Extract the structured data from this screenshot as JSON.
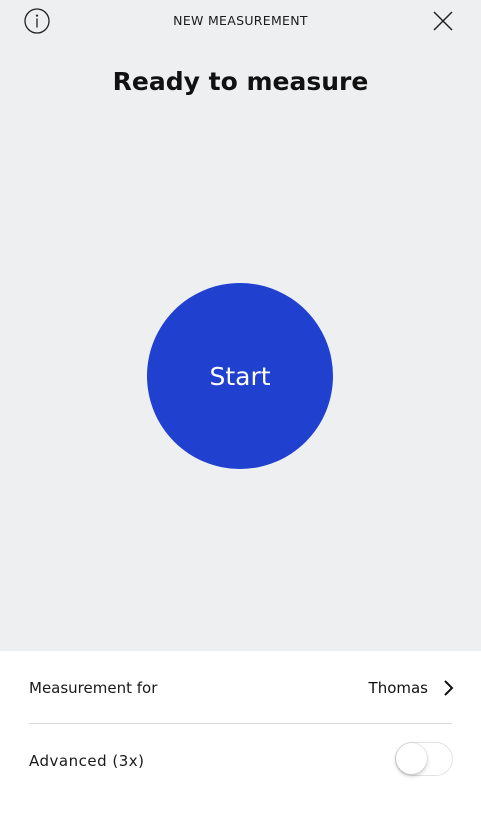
{
  "header": {
    "title": "NEW MEASUREMENT",
    "info_icon": "info-icon",
    "close_icon": "close-icon"
  },
  "main": {
    "title": "Ready to measure",
    "start_label": "Start",
    "accent_color": "#2040d0",
    "background_color": "#eeeff1"
  },
  "settings": {
    "measurement_for_label": "Measurement for",
    "measurement_for_value": "Thomas",
    "advanced_label": "Advanced (3x)",
    "advanced_enabled": false
  }
}
